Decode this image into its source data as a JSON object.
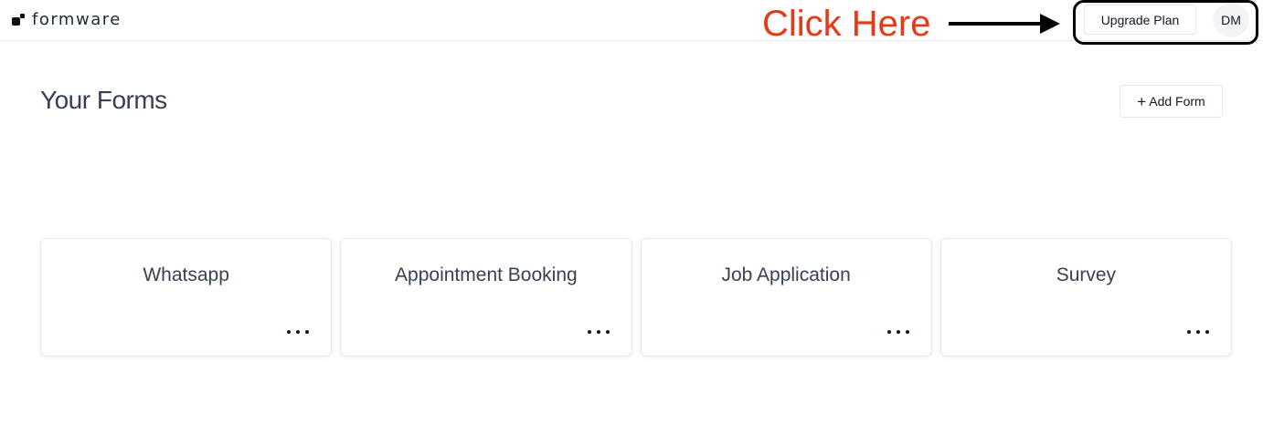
{
  "header": {
    "logo_text": "formware",
    "upgrade_label": "Upgrade Plan",
    "avatar_initials": "DM"
  },
  "annotation": {
    "text": "Click Here",
    "color": "#e53918"
  },
  "main": {
    "title": "Your Forms",
    "add_form_label": "Add Form",
    "add_icon": "plus-icon"
  },
  "forms": [
    {
      "title": "Whatsapp",
      "menu_icon": "more-horizontal-icon"
    },
    {
      "title": "Appointment Booking",
      "menu_icon": "more-horizontal-icon"
    },
    {
      "title": "Job Application",
      "menu_icon": "more-horizontal-icon"
    },
    {
      "title": "Survey",
      "menu_icon": "more-horizontal-icon"
    }
  ]
}
